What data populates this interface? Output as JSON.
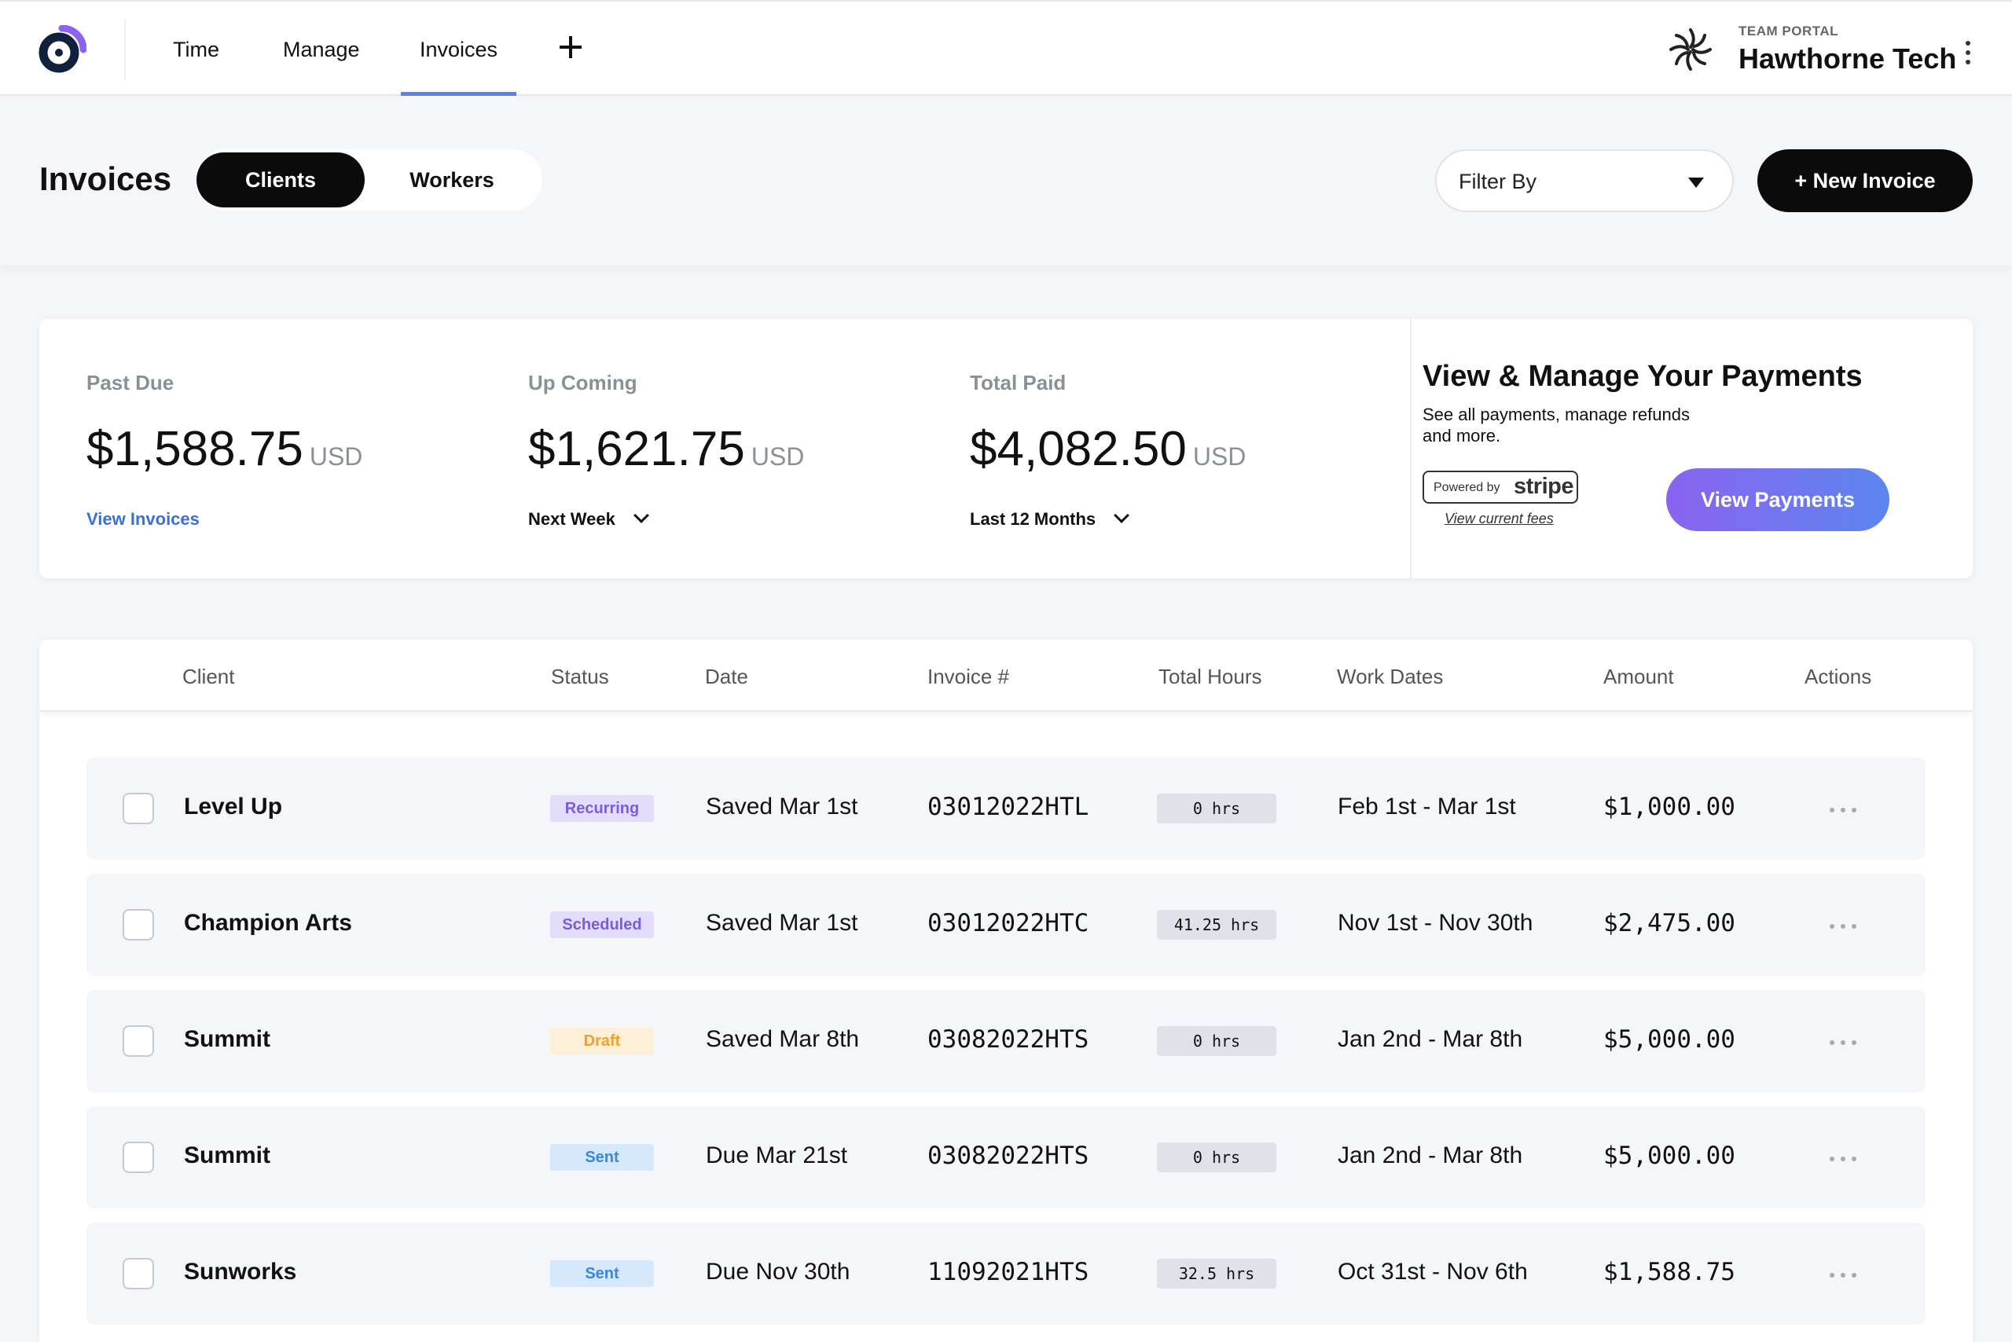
{
  "nav": {
    "items": [
      {
        "label": "Time"
      },
      {
        "label": "Manage"
      },
      {
        "label": "Invoices"
      }
    ],
    "team_label": "TEAM PORTAL",
    "team_name": "Hawthorne Tech",
    "accent": "#5a82e6"
  },
  "header": {
    "title": "Invoices",
    "segment_clients": "Clients",
    "segment_workers": "Workers",
    "filter_label": "Filter By",
    "new_invoice_label": "+ New Invoice"
  },
  "summary": {
    "past_due": {
      "label": "Past Due",
      "amount": "$1,588.75",
      "unit": "USD",
      "link": "View Invoices"
    },
    "upcoming": {
      "label": "Up Coming",
      "amount": "$1,621.75",
      "unit": "USD",
      "range": "Next Week"
    },
    "total_paid": {
      "label": "Total Paid",
      "amount": "$4,082.50",
      "unit": "USD",
      "range": "Last 12 Months"
    },
    "payments": {
      "title": "View & Manage Your Payments",
      "desc": "See all payments, manage refunds and more.",
      "powered_by": "Powered by",
      "stripe": "stripe",
      "fees_link": "View current fees",
      "button": "View Payments"
    }
  },
  "table": {
    "columns": {
      "client": "Client",
      "status": "Status",
      "date": "Date",
      "invoice": "Invoice #",
      "hours": "Total Hours",
      "work_dates": "Work Dates",
      "amount": "Amount",
      "actions": "Actions"
    },
    "rows": [
      {
        "client": "Level Up",
        "status": "Recurring",
        "date": "Saved Mar 1st",
        "invoice": "03012022HTL",
        "hours": "0 hrs",
        "work_dates": "Feb 1st - Mar 1st",
        "amount": "$1,000.00"
      },
      {
        "client": "Champion Arts",
        "status": "Scheduled",
        "date": "Saved Mar 1st",
        "invoice": "03012022HTC",
        "hours": "41.25 hrs",
        "work_dates": "Nov 1st - Nov 30th",
        "amount": "$2,475.00"
      },
      {
        "client": "Summit",
        "status": "Draft",
        "date": "Saved Mar 8th",
        "invoice": "03082022HTS",
        "hours": "0 hrs",
        "work_dates": "Jan 2nd - Mar 8th",
        "amount": "$5,000.00"
      },
      {
        "client": "Summit",
        "status": "Sent",
        "date": "Due Mar 21st",
        "invoice": "03082022HTS",
        "hours": "0 hrs",
        "work_dates": "Jan 2nd - Mar 8th",
        "amount": "$5,000.00"
      },
      {
        "client": "Sunworks",
        "status": "Sent",
        "date": "Due Nov 30th",
        "invoice": "11092021HTS",
        "hours": "32.5 hrs",
        "work_dates": "Oct 31st - Nov 6th",
        "amount": "$1,588.75"
      }
    ],
    "status_colors": {
      "Recurring": {
        "bg": "#e3dcfb",
        "fg": "#7a5ce0"
      },
      "Scheduled": {
        "bg": "#e3dcfb",
        "fg": "#7a5ce0"
      },
      "Draft": {
        "bg": "#fdf0d8",
        "fg": "#f0a030"
      },
      "Sent": {
        "bg": "#d6e8fb",
        "fg": "#3a86e0"
      }
    }
  }
}
